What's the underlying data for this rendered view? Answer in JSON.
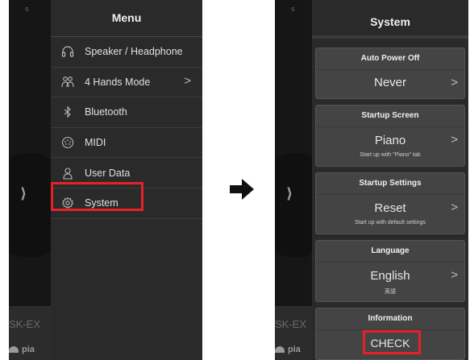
{
  "left_screen": {
    "background": {
      "model_fragment": "SK-EX",
      "tab_fragment": "pia",
      "top_mark": "s"
    },
    "menu": {
      "title": "Menu",
      "items": [
        {
          "label": "Speaker / Headphone",
          "icon": "headphone-icon",
          "has_chevron": false
        },
        {
          "label": "4 Hands Mode",
          "icon": "four-hands-icon",
          "has_chevron": true,
          "chevron": ">"
        },
        {
          "label": "Bluetooth",
          "icon": "bluetooth-icon",
          "has_chevron": false
        },
        {
          "label": "MIDI",
          "icon": "midi-icon",
          "has_chevron": false
        },
        {
          "label": "User Data",
          "icon": "user-icon",
          "has_chevron": false
        },
        {
          "label": "System",
          "icon": "gear-icon",
          "has_chevron": false,
          "highlighted": true
        }
      ]
    }
  },
  "right_screen": {
    "background": {
      "model_fragment": "SK-EX",
      "tab_fragment": "pia",
      "top_mark": "s"
    },
    "system": {
      "title": "System",
      "cards": [
        {
          "title": "Auto Power Off",
          "value": "Never",
          "sub": "",
          "chevron": ">"
        },
        {
          "title": "Startup Screen",
          "value": "Piano",
          "sub": "Start up with \"Piano\" tab",
          "chevron": ">"
        },
        {
          "title": "Startup Settings",
          "value": "Reset",
          "sub": "Start up with default settings",
          "chevron": ">"
        },
        {
          "title": "Language",
          "value": "English",
          "sub": "英語",
          "chevron": ">"
        },
        {
          "title": "Information",
          "value": "CHECK",
          "sub": "",
          "chevron": "",
          "highlighted": true
        }
      ]
    }
  },
  "colors": {
    "highlight": "#e8202a",
    "panel": "#2a2a2a",
    "card": "#444444"
  }
}
